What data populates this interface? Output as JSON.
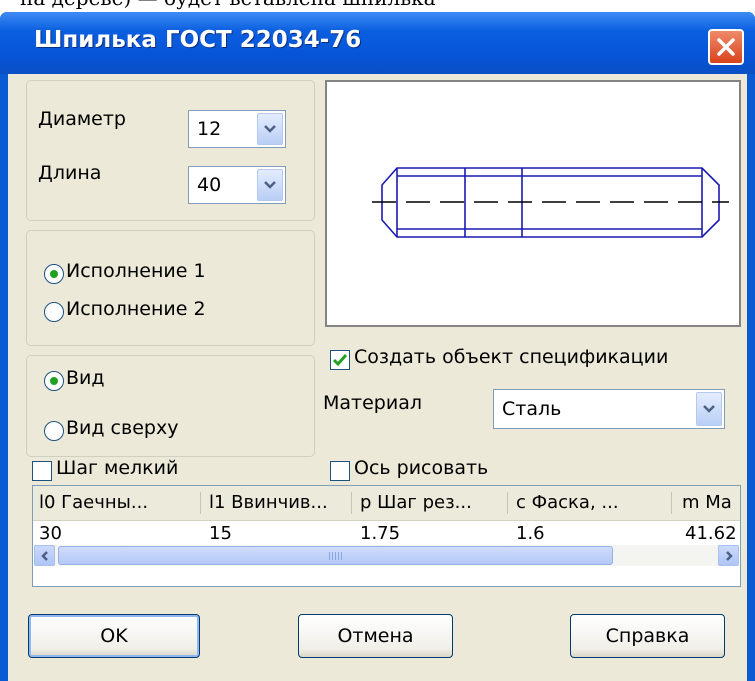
{
  "top_fragment": "на дереве) — будет вставлена шпилька",
  "window": {
    "title": "Шпилька ГОСТ 22034-76"
  },
  "params": {
    "diameter_label": "Диаметр",
    "diameter_value": "12",
    "length_label": "Длина",
    "length_value": "40"
  },
  "execution": {
    "option1": "Исполнение 1",
    "option2": "Исполнение 2",
    "selected": 1
  },
  "view": {
    "option1": "Вид",
    "option2": "Вид сверху",
    "selected": 1
  },
  "spec": {
    "create_label": "Создать объект спецификации",
    "create_checked": true,
    "material_label": "Материал",
    "material_value": "Сталь"
  },
  "fine_pitch": {
    "label": "Шаг мелкий",
    "checked": false
  },
  "draw_axis": {
    "label": "Ось рисовать",
    "checked": false
  },
  "table": {
    "headers": [
      "l0 Гаечны...",
      "l1 Ввинчив...",
      "p Шаг рез...",
      "c Фаска, ...",
      "m Ма"
    ],
    "row": [
      "30",
      "15",
      "1.75",
      "1.6",
      "41.62"
    ]
  },
  "buttons": {
    "ok": "OK",
    "cancel": "Отмена",
    "help": "Справка"
  },
  "colors": {
    "titlebar": "#0654d8",
    "face": "#ece9d8",
    "drawing": "#1a1ab0",
    "radio_dot": "#21a121",
    "checkmark": "#21a121"
  }
}
